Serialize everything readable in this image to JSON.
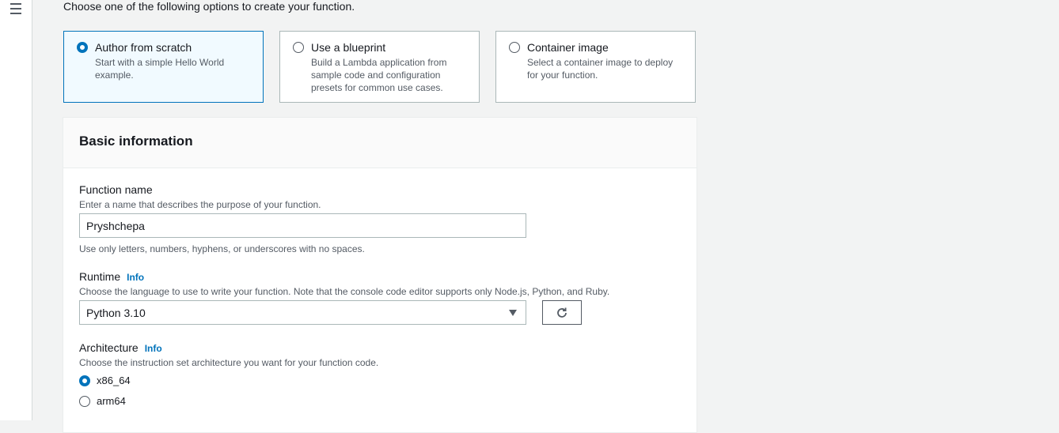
{
  "intro_text": "Choose one of the following options to create your function.",
  "accent_color": "#0073bb",
  "options": [
    {
      "title": "Author from scratch",
      "description": "Start with a simple Hello World example.",
      "selected": true
    },
    {
      "title": "Use a blueprint",
      "description": "Build a Lambda application from sample code and configuration presets for common use cases.",
      "selected": false
    },
    {
      "title": "Container image",
      "description": "Select a container image to deploy for your function.",
      "selected": false
    }
  ],
  "basic_info": {
    "title": "Basic information",
    "function_name": {
      "label": "Function name",
      "description": "Enter a name that describes the purpose of your function.",
      "value": "Pryshchepa",
      "constraint": "Use only letters, numbers, hyphens, or underscores with no spaces."
    },
    "runtime": {
      "label": "Runtime",
      "info": "Info",
      "description": "Choose the language to use to write your function. Note that the console code editor supports only Node.js, Python, and Ruby.",
      "selected": "Python 3.10"
    },
    "architecture": {
      "label": "Architecture",
      "info": "Info",
      "description": "Choose the instruction set architecture you want for your function code.",
      "options": [
        {
          "label": "x86_64",
          "selected": true
        },
        {
          "label": "arm64",
          "selected": false
        }
      ]
    }
  },
  "icons": {
    "menu": "hamburger-menu-icon",
    "refresh": "refresh-icon",
    "dropdown": "caret-down-icon"
  }
}
